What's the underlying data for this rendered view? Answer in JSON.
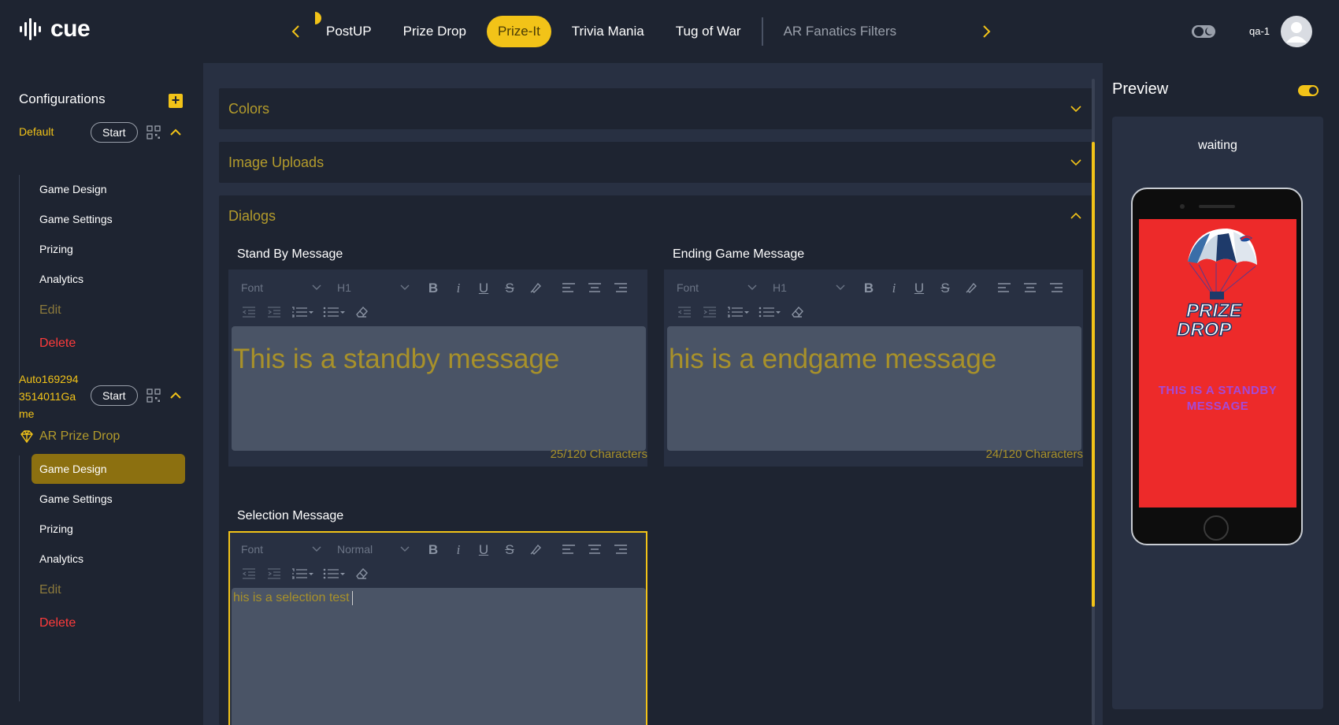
{
  "app": {
    "logo_text": "cue",
    "user_name": "qa-1"
  },
  "tabs": [
    {
      "label": "PostUP"
    },
    {
      "label": "Prize Drop"
    },
    {
      "label": "Prize-It",
      "active": true
    },
    {
      "label": "Trivia Mania"
    },
    {
      "label": "Tug of War"
    },
    {
      "label": "AR Fanatics Filters",
      "dimmed": true
    }
  ],
  "sidebar": {
    "title": "Configurations",
    "add_label": "+",
    "configs": [
      {
        "name": "Default",
        "start_label": "Start",
        "items": [
          "Game Design",
          "Game Settings",
          "Prizing",
          "Analytics"
        ],
        "edit_label": "Edit",
        "delete_label": "Delete"
      },
      {
        "name_lines": [
          "Auto169294",
          "3514011Ga",
          "me"
        ],
        "start_label": "Start",
        "ar_label": "AR Prize Drop",
        "items": [
          "Game Design",
          "Game Settings",
          "Prizing",
          "Analytics"
        ],
        "active_item": "Game Design",
        "edit_label": "Edit",
        "delete_label": "Delete"
      }
    ]
  },
  "main": {
    "sections": [
      {
        "title": "Colors",
        "expanded": false
      },
      {
        "title": "Image Uploads",
        "expanded": false
      },
      {
        "title": "Dialogs",
        "expanded": true
      }
    ],
    "editors": {
      "standby": {
        "label": "Stand By Message",
        "font_select": "Font",
        "size_select": "H1",
        "text": "This is a standby message",
        "char_count": "25/120 Characters"
      },
      "ending": {
        "label": "Ending Game Message",
        "font_select": "Font",
        "size_select": "H1",
        "text": "his is a endgame message",
        "char_count": "24/120 Characters"
      },
      "selection": {
        "label": "Selection Message",
        "font_select": "Font",
        "size_select": "Normal",
        "text": "his is a selection test"
      }
    },
    "toolbar_icons": [
      "bold-icon",
      "italic-icon",
      "underline-icon",
      "strikethrough-icon",
      "highlight-icon",
      "align-left-icon",
      "align-center-icon",
      "align-right-icon",
      "outdent-icon",
      "indent-icon",
      "ordered-list-icon",
      "bullet-list-icon",
      "clear-format-icon"
    ],
    "toolbar_glyphs": {
      "bold": "B",
      "italic": "i",
      "underline": "U",
      "strike": "S"
    }
  },
  "preview": {
    "title": "Preview",
    "status": "waiting",
    "phone_logo_lines": [
      "PRIZE",
      "DROP"
    ],
    "phone_message": "THIS IS A STANDBY MESSAGE"
  },
  "colors": {
    "accent": "#f2c318",
    "danger": "#ff3b3b",
    "panel": "#283042",
    "background": "#1e2431",
    "phone_screen": "#ed2a2a",
    "phone_message": "#a44ad8"
  }
}
